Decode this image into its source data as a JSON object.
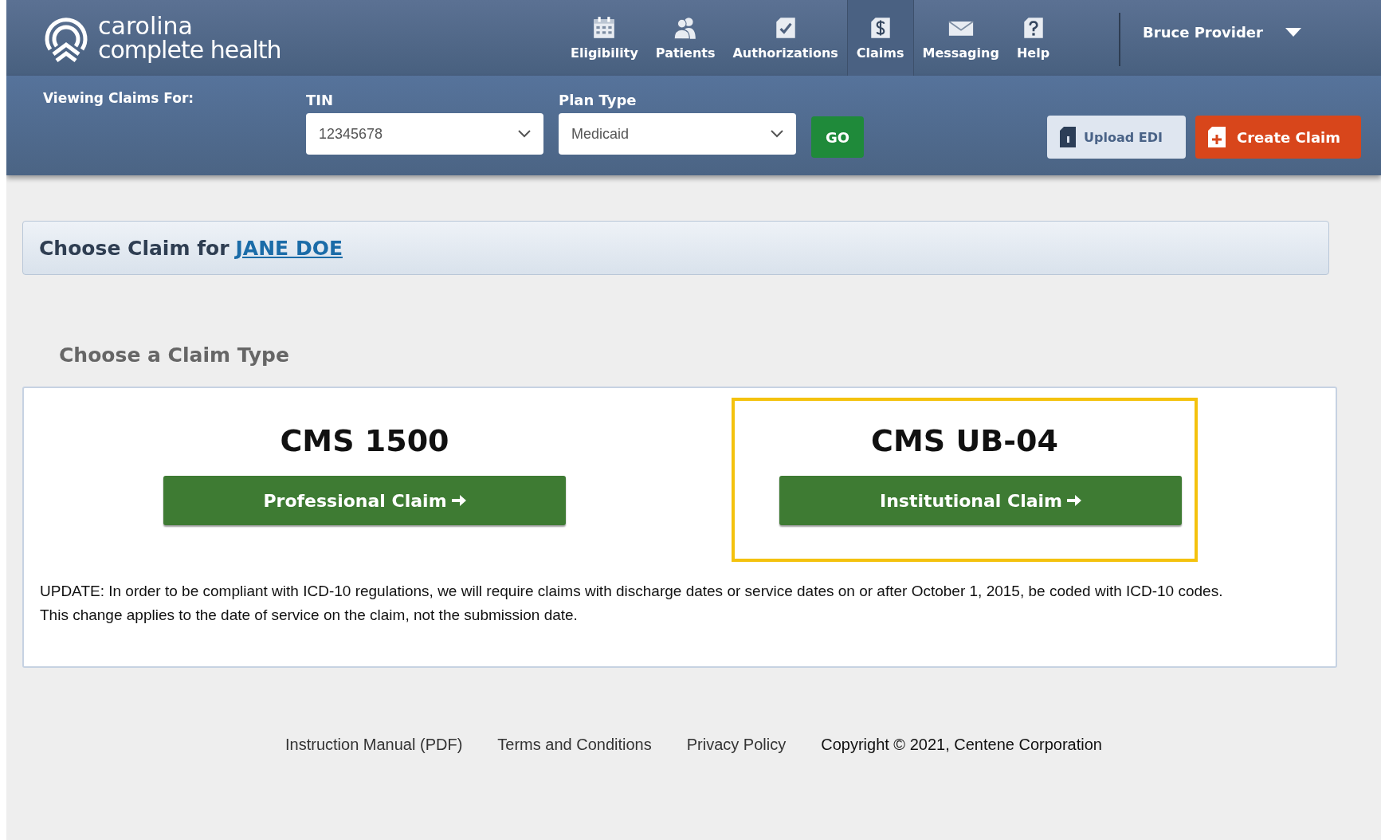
{
  "logo": {
    "line_1": "carolina",
    "line_2": "complete health"
  },
  "nav": [
    {
      "label": "Eligibility",
      "selected": false
    },
    {
      "label": "Patients",
      "selected": false
    },
    {
      "label": "Authorizations",
      "selected": false
    },
    {
      "label": "Claims",
      "selected": true
    },
    {
      "label": "Messaging",
      "selected": false
    },
    {
      "label": "Help",
      "selected": false
    }
  ],
  "user_menu": {
    "name": "Bruce Provider"
  },
  "filter_bar": {
    "label": "Viewing Claims For:",
    "tin": {
      "label": "TIN",
      "value": "12345678"
    },
    "plan_type": {
      "label": "Plan Type",
      "value": "Medicaid"
    },
    "go_button": "GO",
    "upload_button": "Upload EDI",
    "create_button": "Create Claim"
  },
  "banner": {
    "text": "Choose Claim for",
    "patient_link": "JANE DOE"
  },
  "section_title": "Choose a Claim Type",
  "claim_types": [
    {
      "title": "CMS 1500",
      "button": "Professional Claim",
      "highlighted": false
    },
    {
      "title": "CMS UB-04",
      "button": "Institutional Claim",
      "highlighted": true
    }
  ],
  "notice": [
    "UPDATE: In order to be compliant with ICD-10 regulations, we will require claims with discharge dates or service dates on or after October 1, 2015, be coded with ICD-10 codes.",
    "This change applies to the date of service on the claim, not the submission date."
  ],
  "footer": {
    "links": [
      "Instruction Manual (PDF)",
      "Terms and Conditions",
      "Privacy Policy"
    ],
    "copyright": "Copyright © 2021, Centene Corporation"
  }
}
